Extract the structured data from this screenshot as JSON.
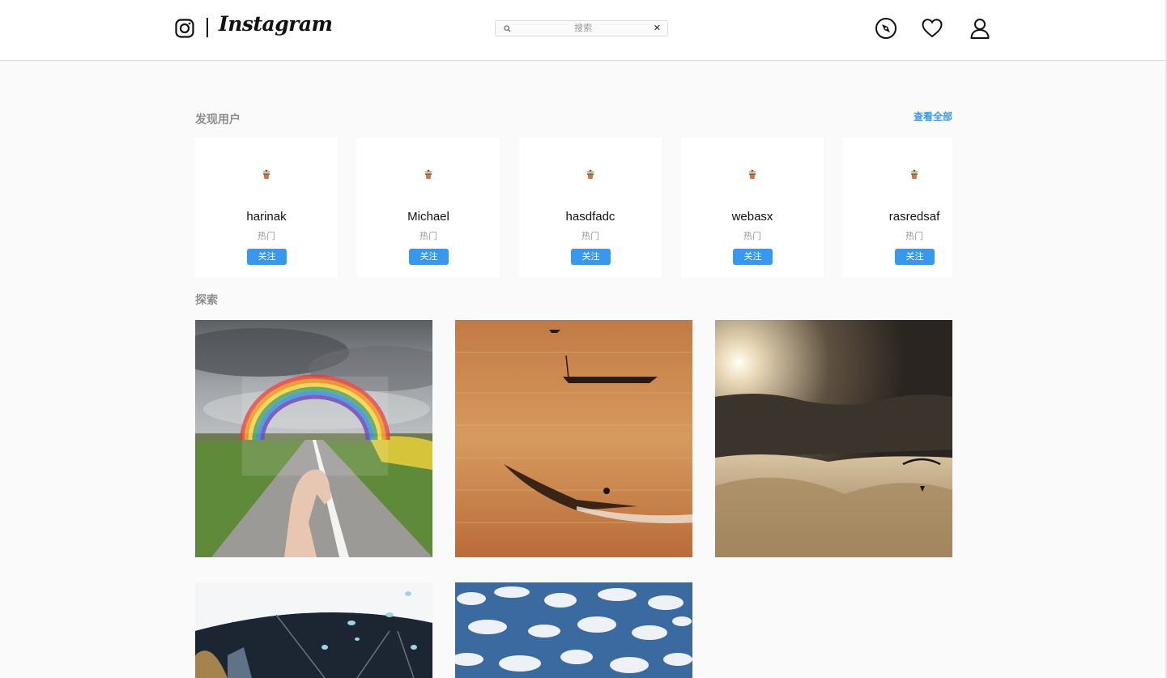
{
  "header": {
    "logo_text": "Instagram",
    "search": {
      "placeholder": "搜索",
      "clear_glyph": "✕"
    },
    "nav_icons": [
      "compass-icon",
      "heart-icon",
      "profile-icon"
    ]
  },
  "discover": {
    "title": "发现用户",
    "see_all_label": "查看全部",
    "users": [
      {
        "name": "harinak",
        "tag": "热门",
        "follow_label": "关注"
      },
      {
        "name": "Michael",
        "tag": "热门",
        "follow_label": "关注"
      },
      {
        "name": "hasdfadc",
        "tag": "热门",
        "follow_label": "关注"
      },
      {
        "name": "webasx",
        "tag": "热门",
        "follow_label": "关注"
      },
      {
        "name": "rasredsaf",
        "tag": "热门",
        "follow_label": "关注"
      }
    ]
  },
  "explore": {
    "title": "探索",
    "photos": [
      "rainbow-road",
      "boats-sunset-lake",
      "paraglider-fog",
      "glass-ceiling",
      "cloudy-sky"
    ]
  },
  "colors": {
    "accent": "#3897f0",
    "background": "#fafafa",
    "card": "#ffffff",
    "muted_text": "#8e8e8e"
  }
}
